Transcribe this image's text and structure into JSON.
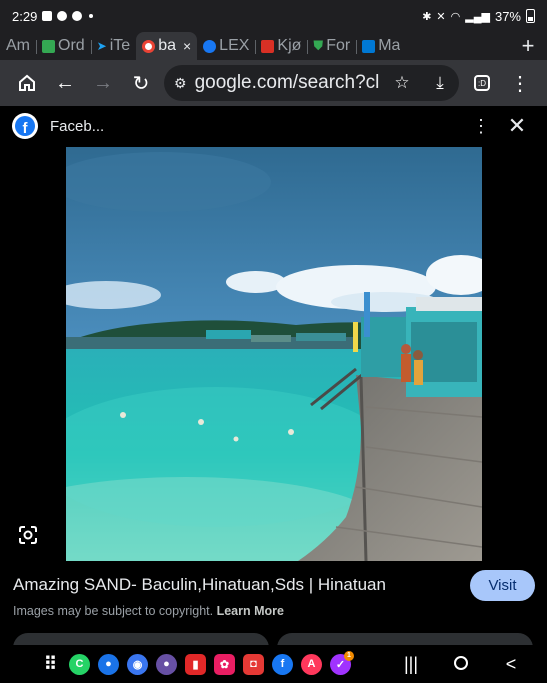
{
  "status_bar": {
    "time": "2:29",
    "battery": "37%"
  },
  "tabs": [
    {
      "label": "Am",
      "icon": "partial-favicon",
      "color": "#9aa0a6",
      "active": false
    },
    {
      "label": "Ord",
      "icon": "sheets-icon",
      "color": "#34a853",
      "active": false
    },
    {
      "label": "iTe",
      "icon": "bird-icon",
      "color": "#1da1f2",
      "active": false
    },
    {
      "label": "ba",
      "icon": "google-icon",
      "color": "#ea4335",
      "active": true,
      "close": "×"
    },
    {
      "label": "LEX",
      "icon": "facebook-icon",
      "color": "#1877f2",
      "active": false
    },
    {
      "label": "Kjø",
      "icon": "red-bag-icon",
      "color": "#d93025",
      "active": false
    },
    {
      "label": "For",
      "icon": "shield-icon",
      "color": "#34a853",
      "active": false
    },
    {
      "label": "Ma",
      "icon": "outlook-icon",
      "color": "#0078d4",
      "active": false
    }
  ],
  "toolbar": {
    "url": "google.com/search?cli",
    "tab_count": ":D"
  },
  "viewer": {
    "source_name": "Faceb...",
    "menu_glyph": "⋮",
    "close_glyph": "✕"
  },
  "result": {
    "title": "Amazing SAND- Baculin,Hinatuan,Sds | Hinatuan",
    "visit_label": "Visit",
    "copyright_text": "Images may be subject to copyright.",
    "learn_more": "Learn More"
  },
  "dock_apps": [
    {
      "name": "apps-grid-icon",
      "color": "#000000",
      "glyph": "⋮⋮"
    },
    {
      "name": "whatsapp-icon",
      "color": "#25d366",
      "glyph": "C"
    },
    {
      "name": "messages-icon",
      "color": "#1a73e8",
      "glyph": "●"
    },
    {
      "name": "signal-icon",
      "color": "#3a76f0",
      "glyph": "◉"
    },
    {
      "name": "purple-app-icon",
      "color": "#6750a4",
      "glyph": "●"
    },
    {
      "name": "flipboard-icon",
      "color": "#e12828",
      "glyph": "▮"
    },
    {
      "name": "flower-app-icon",
      "color": "#e91e63",
      "glyph": "✿"
    },
    {
      "name": "camera-app-icon",
      "color": "#e53935",
      "glyph": "◘"
    },
    {
      "name": "facebook-icon",
      "color": "#1877f2",
      "glyph": "f"
    },
    {
      "name": "airbnb-icon",
      "color": "#ff385c",
      "glyph": "A"
    },
    {
      "name": "messenger-icon",
      "color": "#a033ff",
      "glyph": "✓",
      "badge": "1"
    }
  ]
}
